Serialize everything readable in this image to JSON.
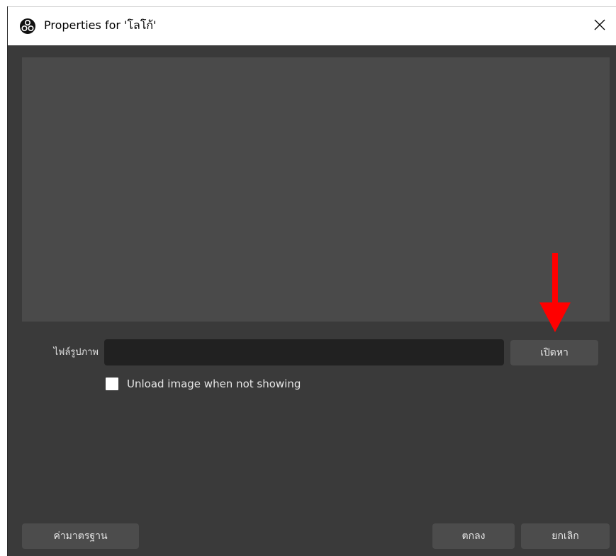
{
  "titlebar": {
    "app_icon": "obs-logo-icon",
    "title": "Properties for 'โลโก้'",
    "close_icon": "close-icon"
  },
  "form": {
    "file_label": "ไฟล์รูปภาพ",
    "file_value": "",
    "browse_label": "เปิดหา",
    "unload_checkbox": {
      "label": "Unload image when not showing",
      "checked": false
    }
  },
  "footer": {
    "defaults_label": "ค่ามาตรฐาน",
    "ok_label": "ตกลง",
    "cancel_label": "ยกเลิก"
  },
  "annotation": {
    "arrow_icon": "red-arrow-down-icon",
    "arrow_color": "#ff0000"
  },
  "colors": {
    "window_bg": "#3a3a3a",
    "preview_bg": "#4a4a4a",
    "input_bg": "#212121",
    "button_bg": "#4c4c4c"
  }
}
